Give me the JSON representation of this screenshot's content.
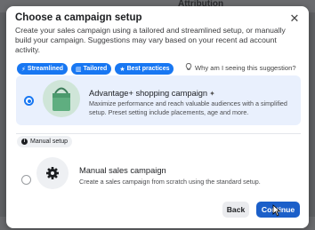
{
  "background": {
    "column_header": "Attribution"
  },
  "dialog": {
    "title": "Choose a campaign setup",
    "subtitle": "Create your sales campaign using a tailored and streamlined setup, or manually build your campaign. Suggestions may vary based on your recent ad account activity.",
    "close_label": "✕",
    "tags": [
      {
        "label": "Streamlined",
        "icon": "⚡"
      },
      {
        "label": "Tailored",
        "icon": "▥"
      },
      {
        "label": "Best practices",
        "icon": "★"
      }
    ],
    "why_link": "Why am I seeing this suggestion?",
    "options": [
      {
        "title": "Advantage+ shopping campaign",
        "description": "Maximize performance and reach valuable audiences with a simplified setup. Preset setting include placements, age and more.",
        "selected": true,
        "icon": "shopping-bag-icon"
      }
    ],
    "manual_section_label": "Manual setup",
    "manual_option": {
      "title": "Manual sales campaign",
      "description": "Create a sales campaign from scratch using the standard setup.",
      "selected": false,
      "icon": "gear-icon"
    },
    "buttons": {
      "back": "Back",
      "continue": "Continue"
    }
  },
  "colors": {
    "accent": "#1877f2",
    "primary_button": "#1b5fc9",
    "selected_card_bg": "#e9f0fd"
  }
}
